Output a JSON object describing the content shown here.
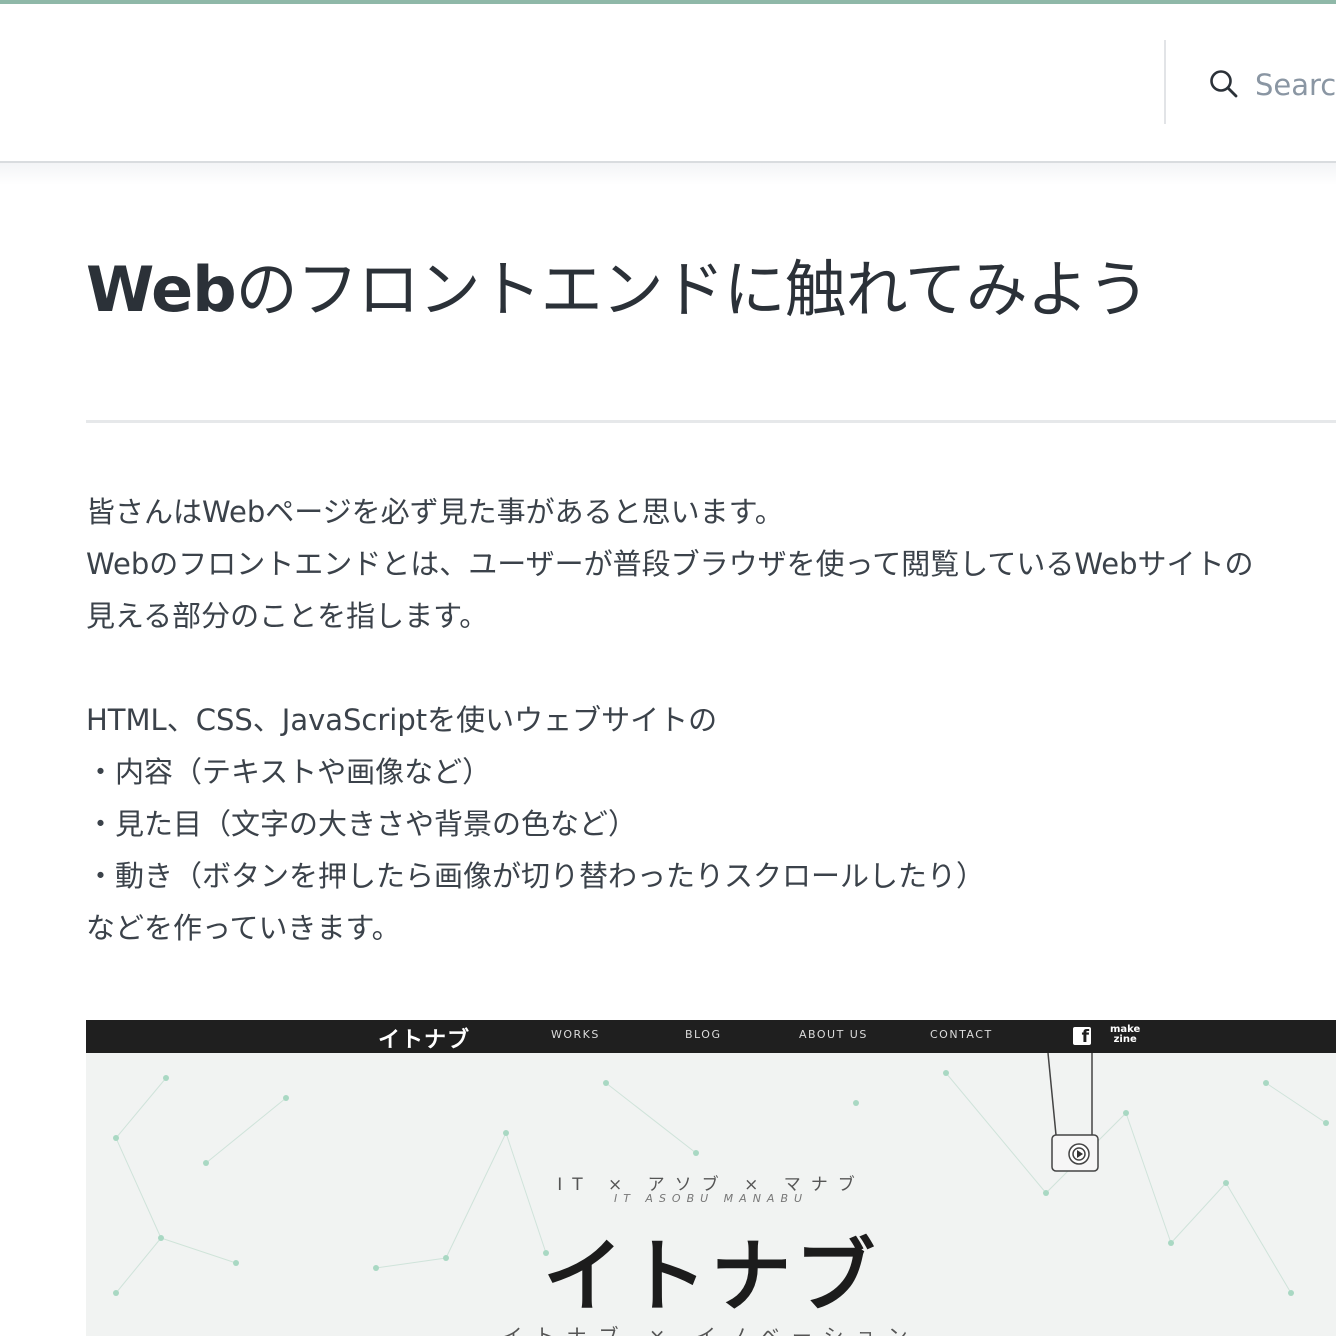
{
  "header": {
    "search_placeholder": "Search"
  },
  "article": {
    "title_latin": "Web",
    "title_rest": "のフロントエンドに触れてみよう",
    "paragraphs": [
      "皆さんはWebページを必ず見た事があると思います。",
      "Webのフロントエンドとは、ユーザーが普段ブラウザを使って閲覧しているWebサイトの",
      "見える部分のことを指します。",
      "HTML、CSS、JavaScriptを使いウェブサイトの",
      "・内容（テキストや画像など）",
      "・見た目（文字の大きさや背景の色など）",
      "・動き（ボタンを押したら画像が切り替わったりスクロールしたり）",
      "などを作っていきます。"
    ]
  },
  "screenshot": {
    "logo": "イトナブ",
    "nav": [
      "WORKS",
      "BLOG",
      "ABOUT US",
      "CONTACT"
    ],
    "social_fb": "f",
    "social_mz_line1": "make",
    "social_mz_line2": "zine",
    "tagline_jp": "IT × アソブ × マナブ",
    "tagline_en": "IT ASOBU MANABU",
    "hero_logo": "イトナブ",
    "subline": "イトナブ × イノベーション"
  },
  "colors": {
    "accent_bar": "#8fb8a8",
    "text": "#2b3138",
    "muted": "#8a96a3",
    "hero_green": "#3ec28f"
  }
}
